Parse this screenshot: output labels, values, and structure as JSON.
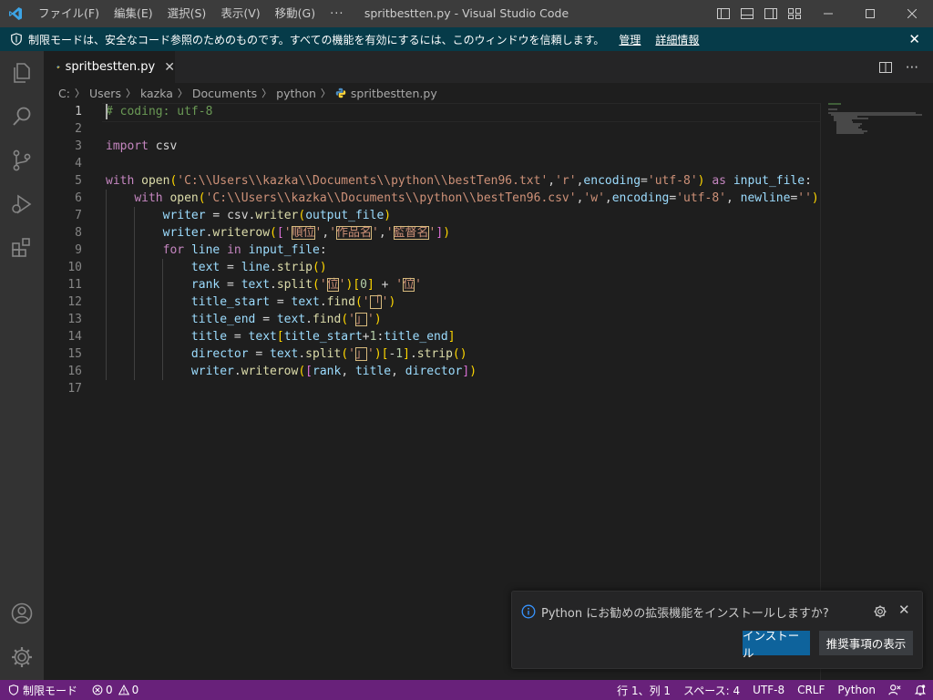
{
  "titlebar": {
    "menu": [
      "ファイル(F)",
      "編集(E)",
      "選択(S)",
      "表示(V)",
      "移動(G)"
    ],
    "more": "···",
    "title": "spritbestten.py - Visual Studio Code"
  },
  "banner": {
    "text": "制限モードは、安全なコード参照のためのものです。すべての機能を有効にするには、このウィンドウを信頼します。",
    "link_manage": "管理",
    "link_details": "詳細情報"
  },
  "tab": {
    "label": "spritbestten.py"
  },
  "breadcrumb": [
    "C:",
    "Users",
    "kazka",
    "Documents",
    "python",
    "spritbestten.py"
  ],
  "editor": {
    "line_numbers": [
      "1",
      "2",
      "3",
      "4",
      "5",
      "6",
      "7",
      "8",
      "9",
      "10",
      "11",
      "12",
      "13",
      "14",
      "15",
      "16",
      "17"
    ],
    "active_line": 1
  },
  "notification": {
    "message": "Python にお勧めの拡張機能をインストールしますか?",
    "primary": "インストール",
    "secondary": "推奨事項の表示"
  },
  "statusbar": {
    "restricted": "制限モード",
    "errors": "0",
    "warnings": "0",
    "position": "行 1、列 1",
    "spaces": "スペース: 4",
    "encoding": "UTF-8",
    "eol": "CRLF",
    "language": "Python"
  },
  "colors": {
    "titlebar": "#3c3c3c",
    "banner": "#063b49",
    "statusbar": "#68217a",
    "editor": "#1e1e1e",
    "primary_button": "#0e639c"
  }
}
